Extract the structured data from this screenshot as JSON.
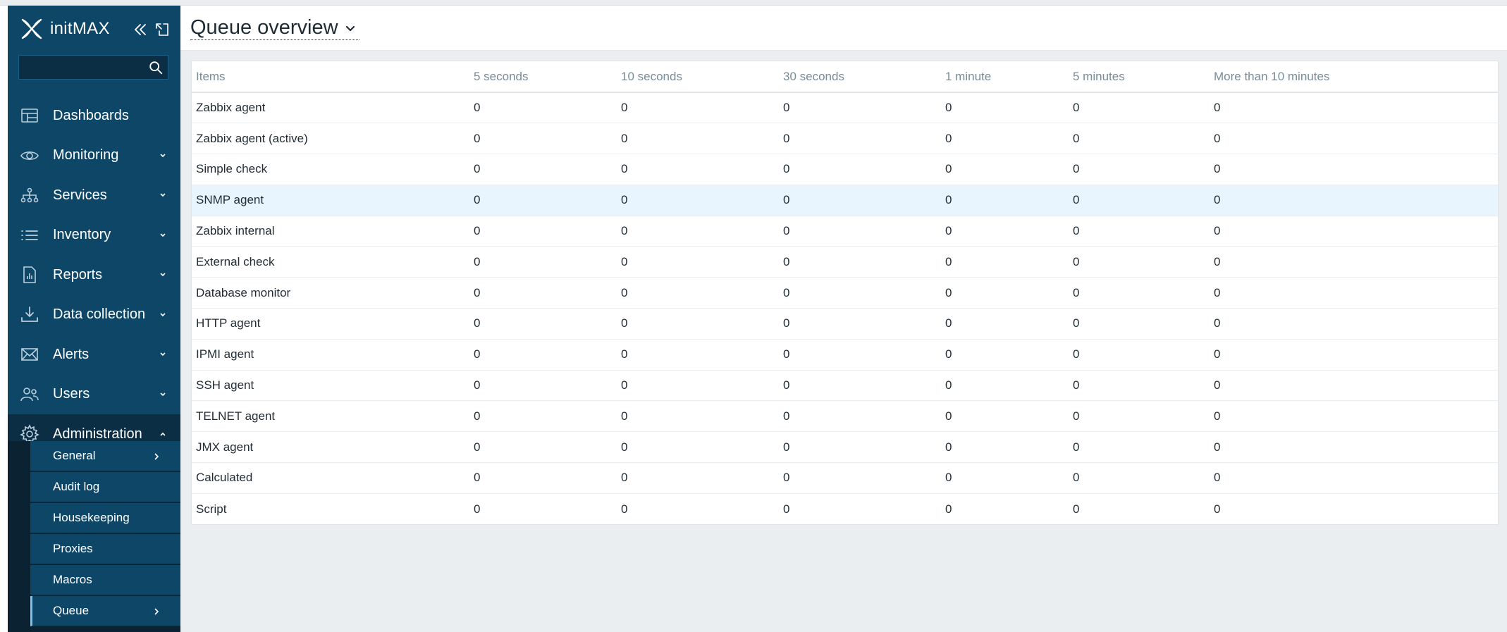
{
  "brand": {
    "name": "initMAX"
  },
  "sidebar": {
    "search_placeholder": "",
    "items": [
      {
        "label": "Dashboards",
        "icon": "dashboards-icon",
        "has_chevron": false
      },
      {
        "label": "Monitoring",
        "icon": "eye-icon",
        "has_chevron": true
      },
      {
        "label": "Services",
        "icon": "services-icon",
        "has_chevron": true
      },
      {
        "label": "Inventory",
        "icon": "list-icon",
        "has_chevron": true
      },
      {
        "label": "Reports",
        "icon": "report-icon",
        "has_chevron": true
      },
      {
        "label": "Data collection",
        "icon": "download-icon",
        "has_chevron": true
      },
      {
        "label": "Alerts",
        "icon": "mail-icon",
        "has_chevron": true
      },
      {
        "label": "Users",
        "icon": "users-icon",
        "has_chevron": true
      },
      {
        "label": "Administration",
        "icon": "gear-icon",
        "has_chevron": true,
        "expanded": true
      }
    ],
    "subitems": [
      {
        "label": "General",
        "has_arrow": true
      },
      {
        "label": "Audit log",
        "has_arrow": false
      },
      {
        "label": "Housekeeping",
        "has_arrow": false
      },
      {
        "label": "Proxies",
        "has_arrow": false
      },
      {
        "label": "Macros",
        "has_arrow": false
      },
      {
        "label": "Queue",
        "has_arrow": true,
        "selected": true
      }
    ]
  },
  "header": {
    "title": "Queue overview"
  },
  "table": {
    "columns": [
      "Items",
      "5 seconds",
      "10 seconds",
      "30 seconds",
      "1 minute",
      "5 minutes",
      "More than 10 minutes"
    ],
    "rows": [
      [
        "Zabbix agent",
        "0",
        "0",
        "0",
        "0",
        "0",
        "0"
      ],
      [
        "Zabbix agent (active)",
        "0",
        "0",
        "0",
        "0",
        "0",
        "0"
      ],
      [
        "Simple check",
        "0",
        "0",
        "0",
        "0",
        "0",
        "0"
      ],
      [
        "SNMP agent",
        "0",
        "0",
        "0",
        "0",
        "0",
        "0"
      ],
      [
        "Zabbix internal",
        "0",
        "0",
        "0",
        "0",
        "0",
        "0"
      ],
      [
        "External check",
        "0",
        "0",
        "0",
        "0",
        "0",
        "0"
      ],
      [
        "Database monitor",
        "0",
        "0",
        "0",
        "0",
        "0",
        "0"
      ],
      [
        "HTTP agent",
        "0",
        "0",
        "0",
        "0",
        "0",
        "0"
      ],
      [
        "IPMI agent",
        "0",
        "0",
        "0",
        "0",
        "0",
        "0"
      ],
      [
        "SSH agent",
        "0",
        "0",
        "0",
        "0",
        "0",
        "0"
      ],
      [
        "TELNET agent",
        "0",
        "0",
        "0",
        "0",
        "0",
        "0"
      ],
      [
        "JMX agent",
        "0",
        "0",
        "0",
        "0",
        "0",
        "0"
      ],
      [
        "Calculated",
        "0",
        "0",
        "0",
        "0",
        "0",
        "0"
      ],
      [
        "Script",
        "0",
        "0",
        "0",
        "0",
        "0",
        "0"
      ]
    ],
    "highlighted_row": 3
  },
  "colors": {
    "sidebar_bg": "#0e4668",
    "sidebar_dark": "#0c2e44",
    "content_bg": "#ebeef0",
    "header_text": "#768d99",
    "row_highlight": "#e8f5ff",
    "selected_marker": "#7cc2ec"
  }
}
